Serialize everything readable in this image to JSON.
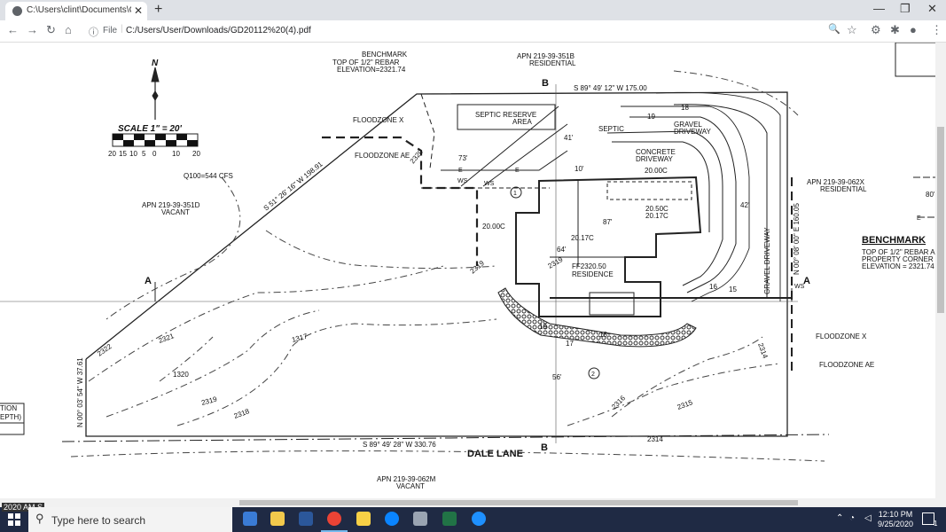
{
  "browser": {
    "tab_title": "C:\\Users\\clint\\Documents\\GG Jo",
    "close_glyph": "✕",
    "new_tab_glyph": "+",
    "address_info_glyph": "ⓘ",
    "address_scheme": "File",
    "address_sep": "|",
    "address_url": "C:/Users/User/Downloads/GD20112%20(4).pdf",
    "window_controls": [
      "—",
      "❐",
      "✕"
    ],
    "nav": {
      "back": "←",
      "forward": "→",
      "reload": "↻",
      "home": "⌂"
    },
    "right_icons": {
      "zoom": "🔍",
      "star": "☆",
      "ext": "⚙",
      "puzzle": "✱",
      "profile": "●",
      "menu": "⋮"
    }
  },
  "drawing": {
    "north_label": "N",
    "scale_label": "SCALE 1\" = 20'",
    "scale_ticks": [
      "20",
      "15",
      "10",
      "5",
      "0",
      "10",
      "20"
    ],
    "benchmark_top": [
      "BENCHMARK",
      "TOP OF 1/2\" REBAR",
      "ELEVATION=2321.74"
    ],
    "apn_top": [
      "APN 219-39-351B",
      "RESIDENTIAL"
    ],
    "bearing_top": "S 89° 49' 12\" W  175.00",
    "section_b": "B",
    "section_a": "A",
    "floodzone_x": "FLOODZONE X",
    "floodzone_ae": "FLOODZONE AE",
    "septic_reserve": [
      "SEPTIC RESERVE",
      "AREA"
    ],
    "septic": "SEPTIC",
    "gravel_driveway_top": [
      "GRAVEL",
      "DRIVEWAY"
    ],
    "concrete_driveway": [
      "CONCRETE",
      "DRIVEWAY"
    ],
    "elev_2000c_a": "20.00C",
    "elev_2000c_b": "20.00C",
    "elev_2050c": "20.50C",
    "elev_2017c_a": "20.17C",
    "elev_2017c_b": "20.17C",
    "ff_residence": [
      "FF2320.50",
      "RESIDENCE"
    ],
    "q100": "Q100=544 CFS",
    "apn_left": [
      "APN 219-39-351D",
      "VACANT"
    ],
    "bearing_diag": "S 51° 26' 16\" W  198.91",
    "apn_right": [
      "APN 219-39-062X",
      "RESIDENTIAL"
    ],
    "benchmark_right": [
      "BENCHMARK",
      "TOP OF 1/2\" REBAR A",
      "PROPERTY CORNER",
      "ELEVATION = 2321.74 N"
    ],
    "gravel_driveway_right": "GRAVEL DRIVEWAY",
    "bearing_right": "N 00° 08' 00\" E  160.05",
    "bearing_left": "N 00° 03' 54\" W  37.61",
    "bearing_bottom": "S 89° 49' 28\" W  330.76",
    "dale_lane": "DALE LANE",
    "apn_bottom": [
      "APN 219-39-062M",
      "VACANT"
    ],
    "contours": [
      "2322",
      "2321",
      "1320",
      "2319",
      "2318",
      "1317",
      "2316",
      "2315",
      "2314",
      "2319",
      "2319",
      "2320",
      "2314",
      "18",
      "19",
      "16",
      "15",
      "17",
      "18",
      "19"
    ],
    "dims": [
      "73'",
      "41'",
      "10'",
      "87'",
      "64'",
      "42'",
      "56'",
      "80'"
    ],
    "callouts": [
      "1",
      "2"
    ],
    "legend_frag": [
      "TION",
      "EPTH)"
    ],
    "ws": "WS",
    "e": "E"
  },
  "taskbar": {
    "search_placeholder": "Type here to search",
    "time": "12:10 PM",
    "date": "9/25/2020",
    "notif": "1",
    "corner_text": "2020 AM S"
  },
  "colors": {
    "tabbar": "#dee1e6",
    "taskbar": "#1f2a44",
    "hatch": "#333333"
  }
}
